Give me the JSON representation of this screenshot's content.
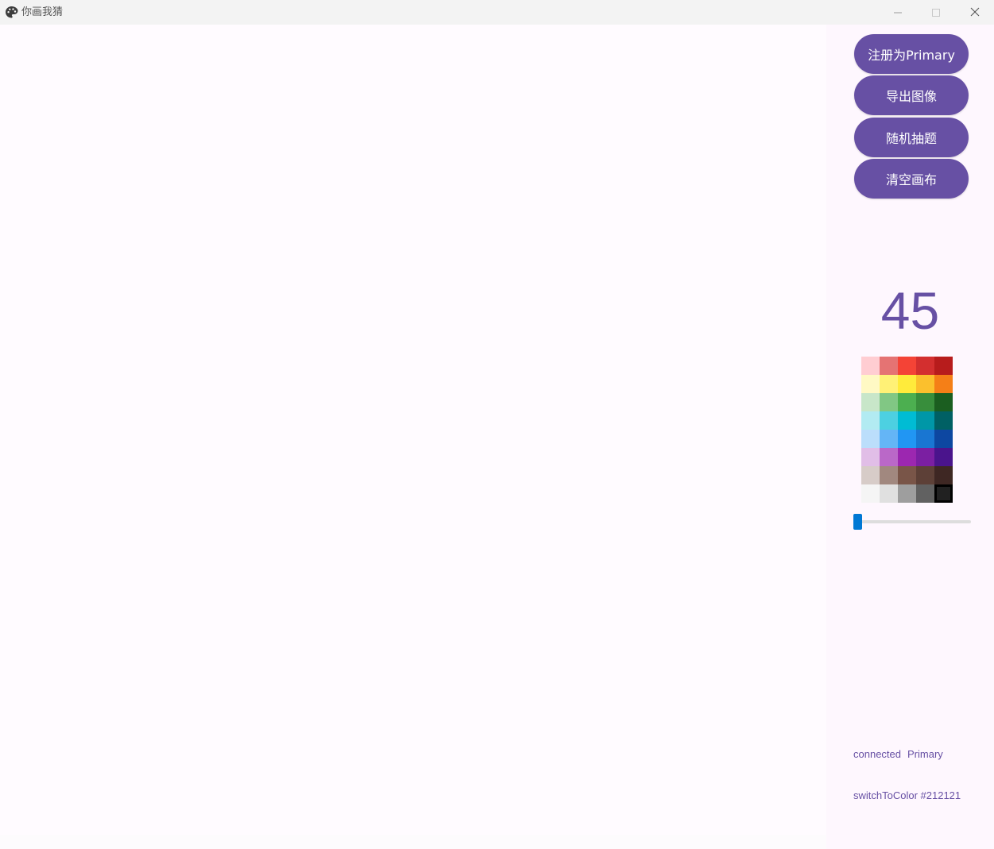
{
  "window": {
    "title": "你画我猜"
  },
  "sidebar": {
    "buttons": {
      "register": "注册为Primary",
      "export": "导出图像",
      "random": "随机抽题",
      "clear": "清空画布"
    },
    "timer": "45",
    "palette": {
      "rows": [
        [
          "#ffcdd2",
          "#e57373",
          "#f44336",
          "#d32f2f",
          "#b71c1c"
        ],
        [
          "#fff9c4",
          "#fff176",
          "#ffeb3b",
          "#fbc02d",
          "#f57f17"
        ],
        [
          "#c8e6c9",
          "#81c784",
          "#4caf50",
          "#388e3c",
          "#1b5e20"
        ],
        [
          "#b2ebf2",
          "#4dd0e1",
          "#00bcd4",
          "#0097a7",
          "#006064"
        ],
        [
          "#bbdefb",
          "#64b5f6",
          "#2196f3",
          "#1976d2",
          "#0d47a1"
        ],
        [
          "#e1bee7",
          "#ba68c8",
          "#9c27b0",
          "#7b1fa2",
          "#4a148c"
        ],
        [
          "#d7ccc8",
          "#a1887f",
          "#795548",
          "#5d4037",
          "#3e2723"
        ],
        [
          "#f5f5f5",
          "#e0e0e0",
          "#9e9e9e",
          "#616161",
          "#212121"
        ]
      ],
      "selected": "#212121"
    },
    "brush_slider": {
      "value": 0
    },
    "status": {
      "connection": "connected",
      "role": "Primary"
    },
    "log": "switchToColor #212121"
  },
  "colors": {
    "accent": "#6750a4",
    "slider": "#0078d4"
  }
}
